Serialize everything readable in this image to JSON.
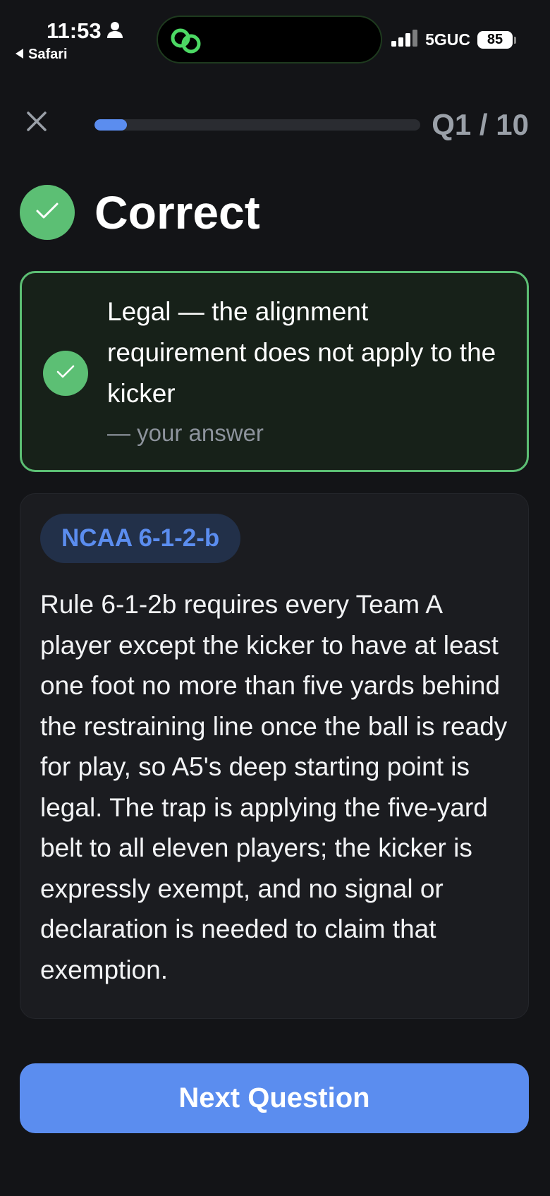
{
  "status_bar": {
    "time": "11:53",
    "back_app": "Safari",
    "network": "5GUC",
    "battery": "85"
  },
  "quiz": {
    "counter": "Q1 / 10",
    "progress_fraction": 0.1
  },
  "result": {
    "title": "Correct",
    "answer_text": "Legal — the alignment requirement does not apply to the kicker",
    "answer_caption": "— your answer"
  },
  "explanation": {
    "rule_tag": "NCAA 6-1-2-b",
    "body": "Rule 6-1-2b requires every Team A player except the kicker to have at least one foot no more than five yards behind the restraining line once the ball is ready for play, so A5's deep starting point is legal. The trap is applying the five-yard belt to all eleven players; the kicker is expressly exempt, and no signal or declaration is needed to claim that exemption."
  },
  "actions": {
    "next_label": "Next Question"
  },
  "colors": {
    "accent": "#5b8def",
    "success": "#5cbf74",
    "background": "#131417"
  },
  "icons": [
    "person-icon",
    "back-arrow-icon",
    "link-icon",
    "signal-icon",
    "battery-icon",
    "close-icon",
    "check-icon"
  ]
}
